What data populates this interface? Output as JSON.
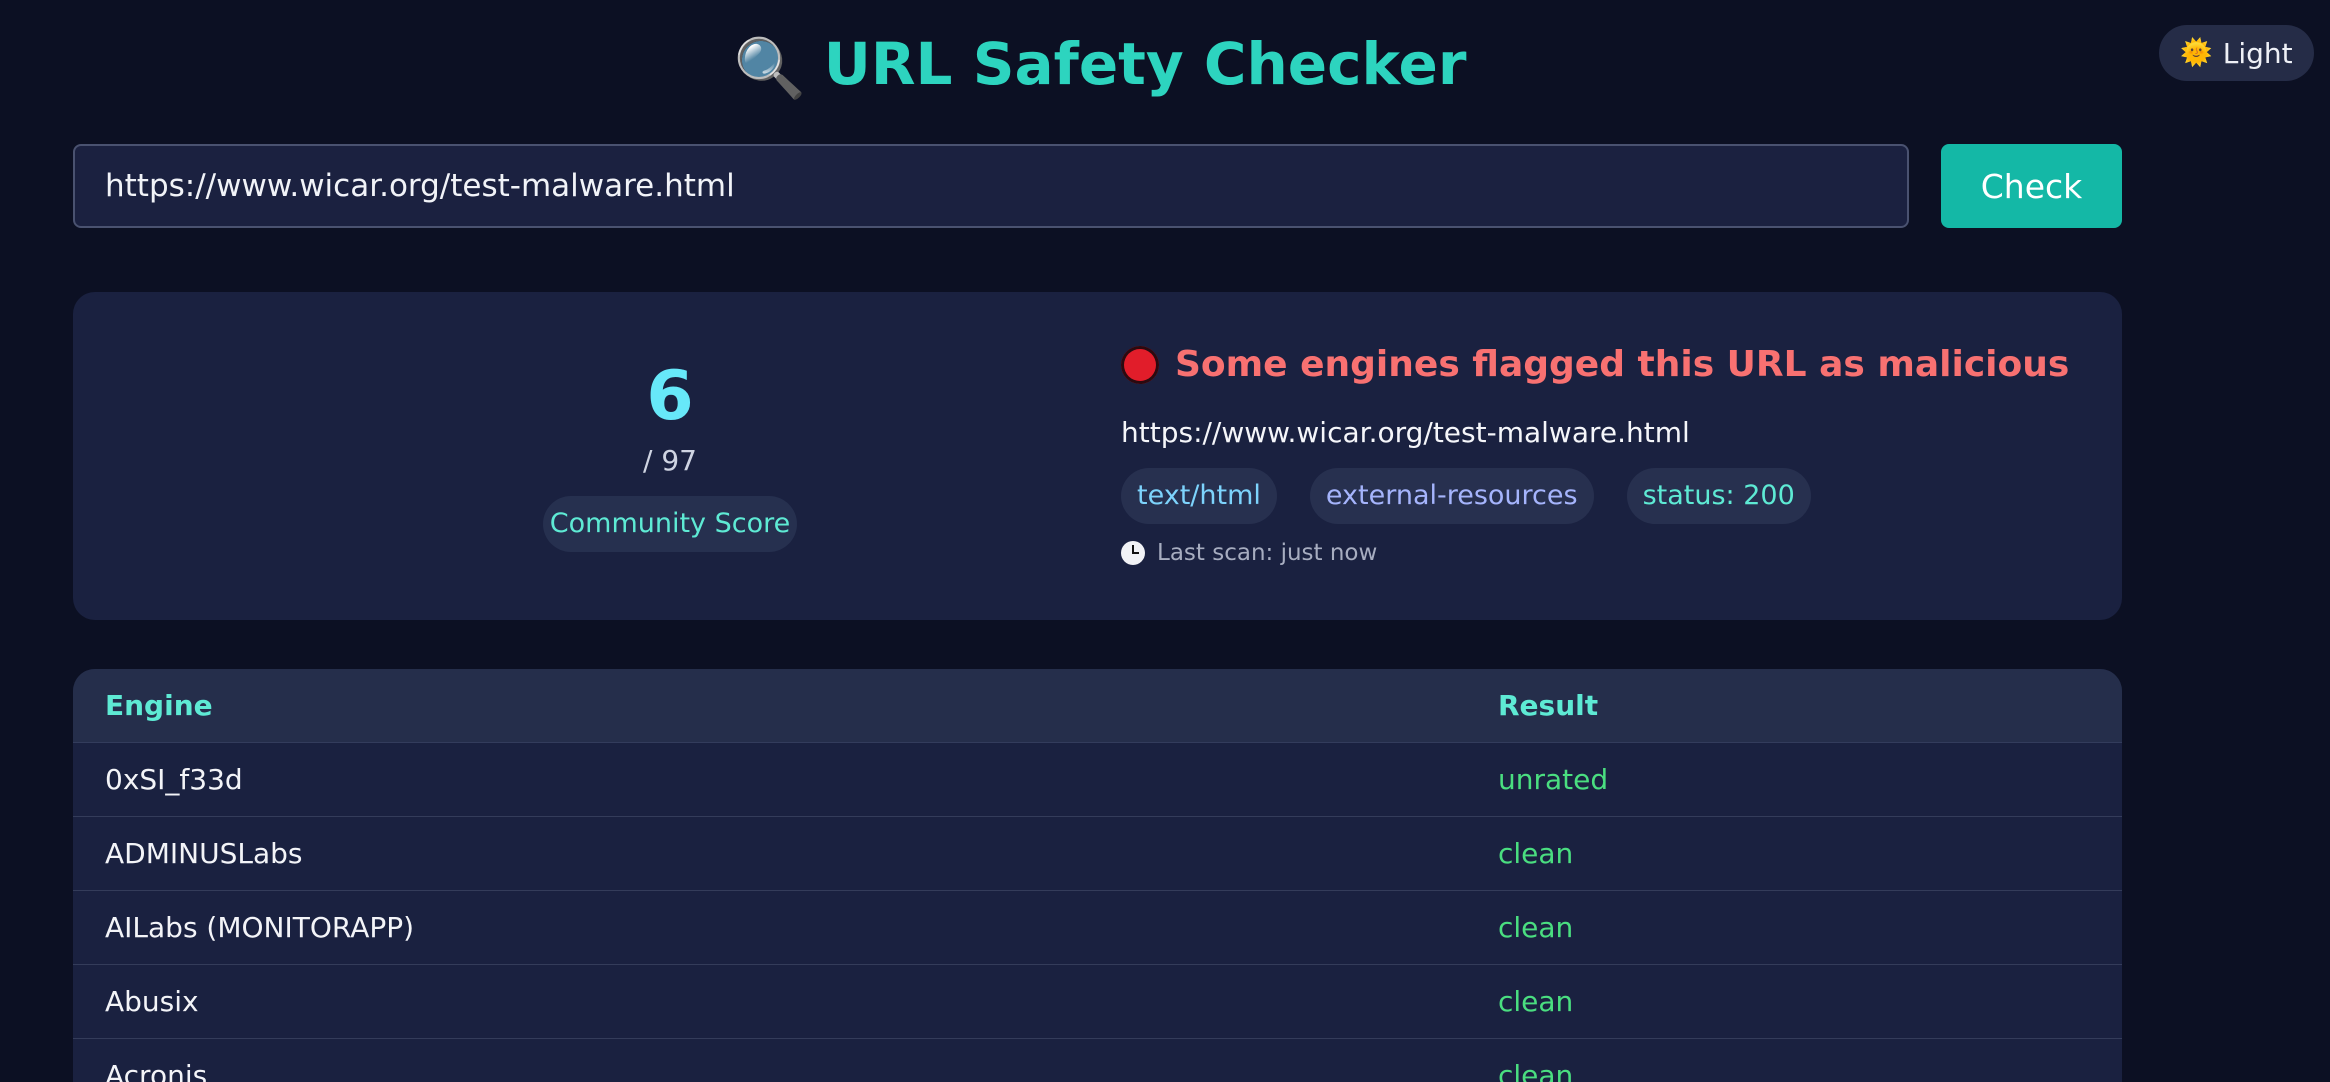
{
  "theme_toggle": {
    "icon": "sun-icon",
    "label": "Light"
  },
  "header": {
    "icon": "magnifier-icon",
    "title": "URL Safety Checker"
  },
  "search": {
    "value": "https://www.wicar.org/test-malware.html",
    "button_label": "Check"
  },
  "summary": {
    "score": "6",
    "total": "/ 97",
    "badge": "Community Score",
    "verdict": "Some engines flagged this URL as malicious",
    "verdict_color": "#f87171",
    "url": "https://www.wicar.org/test-malware.html",
    "tags": [
      "text/html",
      "external-resources",
      "status: 200"
    ],
    "last_scan": "Last scan: just now"
  },
  "table": {
    "columns": [
      "Engine",
      "Result"
    ],
    "rows": [
      {
        "engine": "0xSI_f33d",
        "result": "unrated"
      },
      {
        "engine": "ADMINUSLabs",
        "result": "clean"
      },
      {
        "engine": "AILabs (MONITORAPP)",
        "result": "clean"
      },
      {
        "engine": "Abusix",
        "result": "clean"
      },
      {
        "engine": "Acronis",
        "result": "clean"
      }
    ]
  },
  "colors": {
    "accent": "#2dd4bf",
    "button": "#14b8a6",
    "clean": "#4ade80",
    "background": "#0c1023"
  }
}
